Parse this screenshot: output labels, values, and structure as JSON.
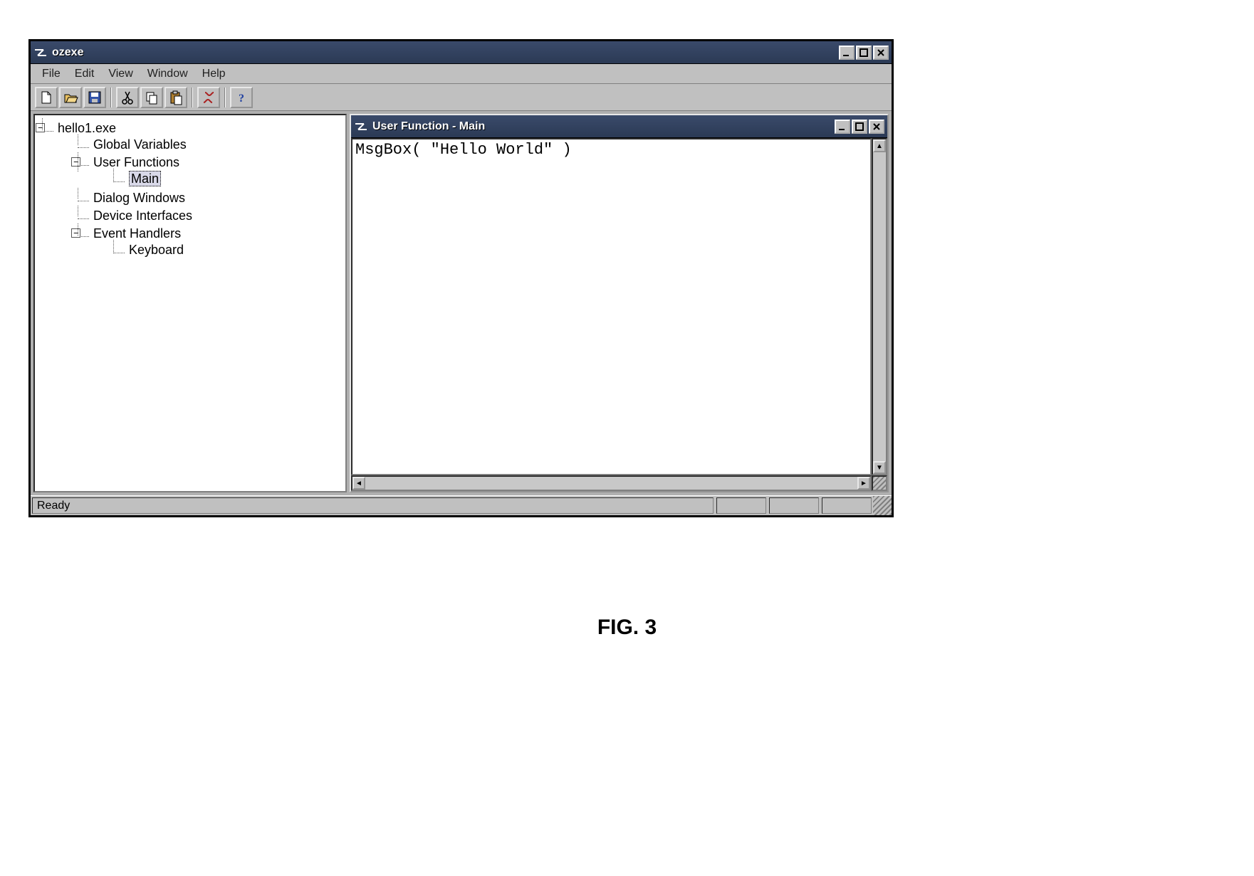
{
  "window": {
    "title": "ozexe"
  },
  "menu": {
    "file": "File",
    "edit": "Edit",
    "view": "View",
    "window": "Window",
    "help": "Help"
  },
  "toolbar": {
    "new": "New",
    "open": "Open",
    "save": "Save",
    "cut": "Cut",
    "copy": "Copy",
    "paste": "Paste",
    "run": "Run",
    "help": "Help"
  },
  "tree": {
    "root": "hello1.exe",
    "global_vars": "Global Variables",
    "user_functions": "User Functions",
    "main": "Main",
    "dialog_windows": "Dialog Windows",
    "device_interfaces": "Device Interfaces",
    "event_handlers": "Event Handlers",
    "keyboard": "Keyboard"
  },
  "child_window": {
    "title": "User Function - Main"
  },
  "editor": {
    "content": "MsgBox( \"Hello World\" )"
  },
  "status": {
    "text": "Ready"
  },
  "figure": {
    "label": "FIG. 3"
  }
}
